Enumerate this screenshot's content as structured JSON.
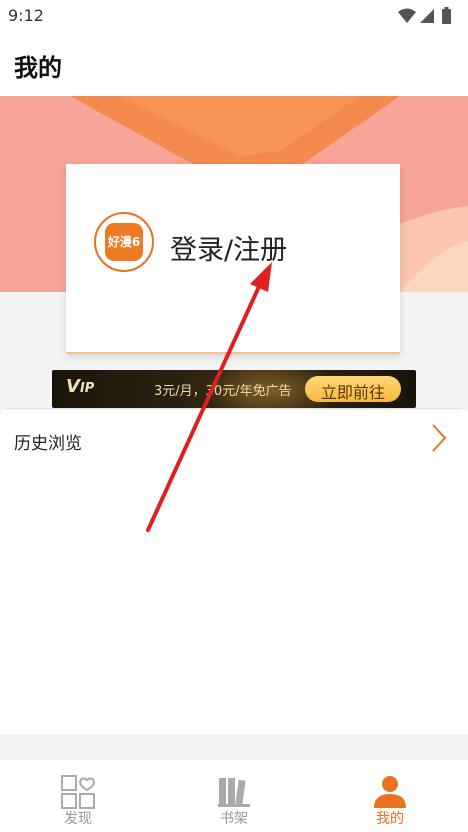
{
  "status_bar": {
    "time": "9:12",
    "icons": [
      "wifi-icon",
      "cellular-signal-icon",
      "battery-icon"
    ]
  },
  "header": {
    "title": "我的"
  },
  "login": {
    "app_logo_text": "好漫6",
    "label": "登录/注册"
  },
  "vip_banner": {
    "mark": "V",
    "mark_suffix": "IP",
    "price_text": "3元/月，30元/年免广告",
    "cta": "立即前往"
  },
  "menu": {
    "history": "历史浏览"
  },
  "tabs": [
    {
      "label": "发现",
      "icon": "grid-heart-icon",
      "active": false
    },
    {
      "label": "书架",
      "icon": "bookshelf-icon",
      "active": false
    },
    {
      "label": "我的",
      "icon": "user-icon",
      "active": true
    }
  ],
  "colors": {
    "accent": "#E8721F",
    "hero_light": "#F8A49A",
    "hero_orange": "#F68A4C",
    "inactive": "#999999"
  }
}
